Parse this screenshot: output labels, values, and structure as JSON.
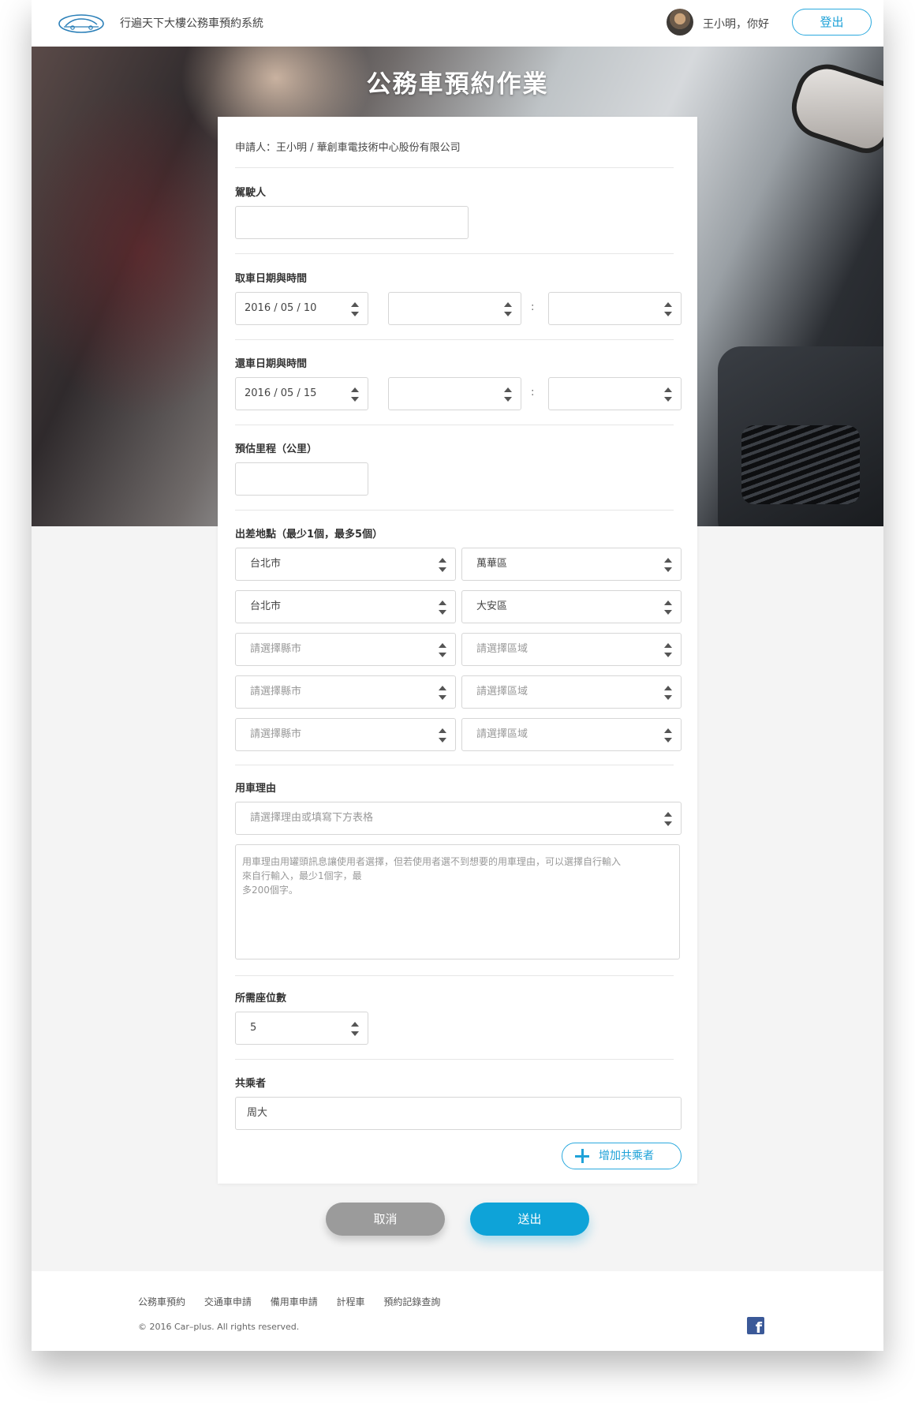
{
  "header": {
    "title": "行遍天下大樓公務車預約系統",
    "greeting": "王小明，你好",
    "logout": "登出"
  },
  "page_title": "公務車預約作業",
  "form": {
    "applicant": "申請人：王小明 / 華創車電技術中心股份有限公司",
    "driver": {
      "label": "駕駛人",
      "value": ""
    },
    "pickup": {
      "label": "取車日期與時間",
      "date": "2016 / 05 / 10",
      "hour": "",
      "minute": "",
      "colon": ":"
    },
    "return": {
      "label": "還車日期與時間",
      "date": "2016 / 05 / 15",
      "hour": "",
      "minute": "",
      "colon": ":"
    },
    "mileage": {
      "label": "預估里程（公里）",
      "value": ""
    },
    "locations": {
      "label": "出差地點（最少1個，最多5個）",
      "rows": [
        {
          "city": "台北市",
          "district": "萬華區"
        },
        {
          "city": "台北市",
          "district": "大安區"
        },
        {
          "city": "請選擇縣市",
          "district": "請選擇區域"
        },
        {
          "city": "請選擇縣市",
          "district": "請選擇區域"
        },
        {
          "city": "請選擇縣市",
          "district": "請選擇區域"
        }
      ]
    },
    "reason": {
      "label": "用車理由",
      "select_placeholder": "請選擇理由或填寫下方表格",
      "textarea_line1": "用車理由用罐頭訊息讓使用者選擇，但若使用者選不到想要的用車理由，可以選擇自行輸入",
      "textarea_line2": "來自行輸入，最少1個字，最",
      "textarea_line3": "多200個字。"
    },
    "seats": {
      "label": "所需座位數",
      "value": "5"
    },
    "passengers": {
      "label": "共乘者",
      "value": "周大",
      "add": "增加共乘者"
    }
  },
  "actions": {
    "cancel": "取消",
    "submit": "送出"
  },
  "footer": {
    "links": [
      "公務車預約",
      "交通車申請",
      "備用車申請",
      "計程車",
      "預約記錄查詢"
    ],
    "copyright": "© 2016  Car–plus. All rights reserved."
  },
  "colors": {
    "accent": "#0ea3d8",
    "cancel": "#9b9b9b"
  }
}
